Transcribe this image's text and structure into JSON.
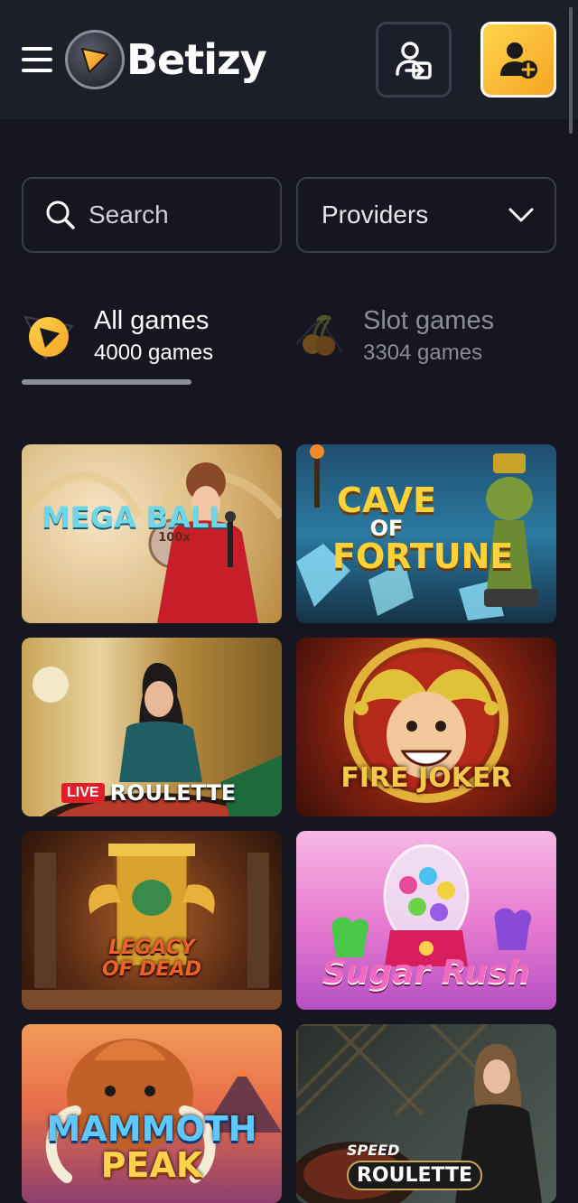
{
  "header": {
    "brand": "Betizy",
    "menu_icon": "hamburger-menu-icon",
    "logo_icon": "play-triangle-logo-icon",
    "login_icon": "user-login-icon",
    "register_icon": "user-plus-icon",
    "accent": "#f6b531"
  },
  "filters": {
    "search_label": "Search",
    "providers_label": "Providers"
  },
  "tabs": [
    {
      "title": "All games",
      "count": "4000 games",
      "active": true,
      "icon": "play-badge-icon"
    },
    {
      "title": "Slot games",
      "count": "3304 games",
      "active": false,
      "icon": "cherries-icon"
    }
  ],
  "games": [
    {
      "name": "MEGA BALL",
      "badge": "100x",
      "art": "mega"
    },
    {
      "name": "CAVE OF FORTUNE",
      "line1": "CAVE",
      "line2": "OF",
      "line3": "FORTUNE",
      "art": "cave"
    },
    {
      "name": "ROULETTE",
      "badge": "LIVE",
      "art": "roulette"
    },
    {
      "name": "FIRE JOKER",
      "art": "joker"
    },
    {
      "name": "LEGACY OF DEAD",
      "line1": "LEGACY",
      "line2": "OF DEAD",
      "art": "legacy"
    },
    {
      "name": "Sugar Rush",
      "art": "sugar"
    },
    {
      "name": "MAMMOTH PEAK",
      "line1": "MAMMOTH",
      "line2": "PEAK",
      "art": "mammoth"
    },
    {
      "name": "ROULETTE",
      "badge": "SPEED",
      "art": "speed"
    }
  ]
}
